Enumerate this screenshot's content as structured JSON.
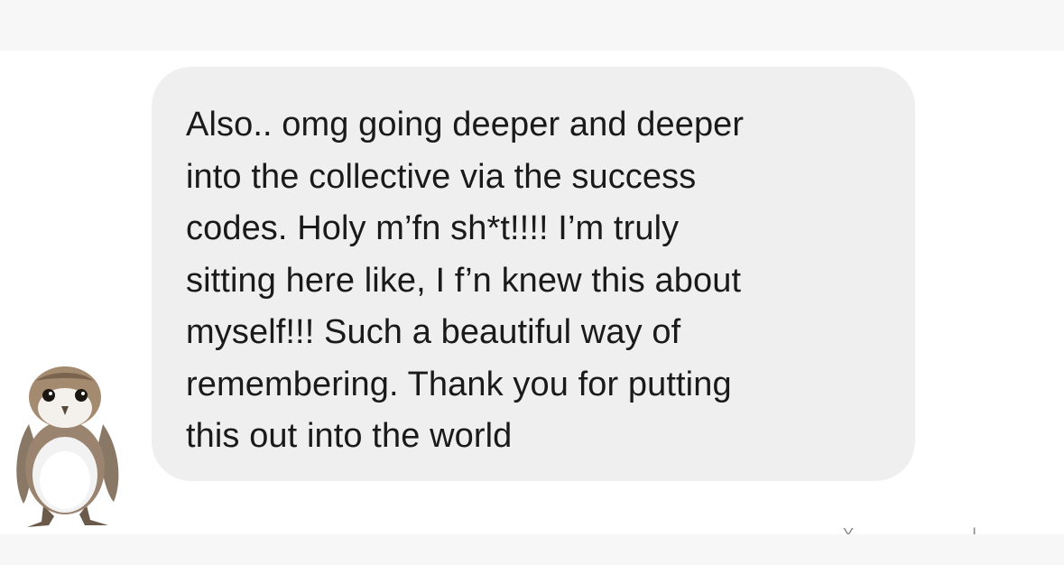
{
  "message": {
    "text": "Also.. omg going deeper and deeper\ninto the collective via the success\ncodes. Holy m’fn sh*t!!!! I’m truly\nsitting here like, I f’n knew this about\nmyself!!! Such a beautiful way of\nremembering. Thank you for putting\nthis out into the world",
    "bubble_color": "#efefef",
    "text_color": "#1a1a1a"
  },
  "sender_avatar": {
    "icon": "porg-sticker-icon"
  },
  "colors": {
    "background": "#ffffff",
    "bands": "#f7f7f7"
  }
}
